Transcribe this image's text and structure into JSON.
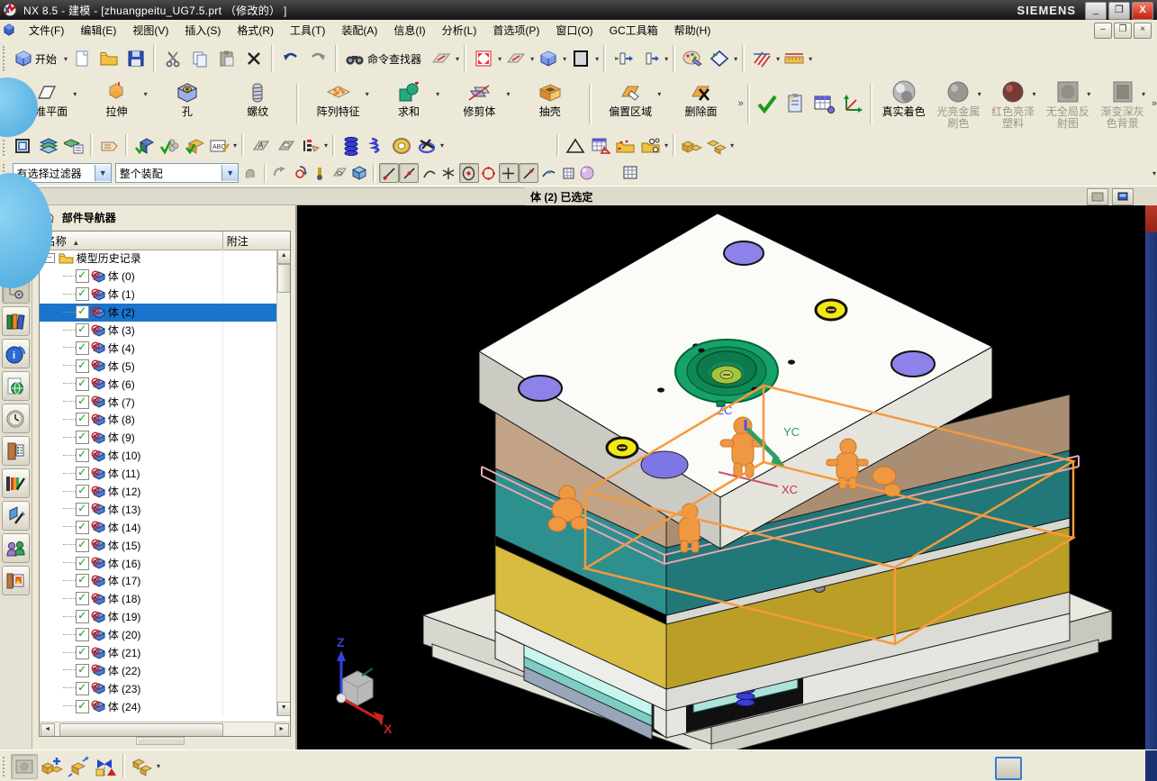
{
  "window": {
    "title": "NX 8.5 - 建模 - [zhuangpeitu_UG7.5.prt （修改的） ]",
    "brand": "SIEMENS",
    "buttons": {
      "minimize": "_",
      "restore": "❐",
      "close": "X"
    }
  },
  "menu": {
    "items": [
      "文件(F)",
      "编辑(E)",
      "视图(V)",
      "插入(S)",
      "格式(R)",
      "工具(T)",
      "装配(A)",
      "信息(I)",
      "分析(L)",
      "首选项(P)",
      "窗口(O)",
      "GC工具箱",
      "帮助(H)"
    ]
  },
  "toolbar_standard": {
    "start_label": "开始",
    "command_finder_label": "命令查找器"
  },
  "feature_toolbar": {
    "buttons": [
      {
        "label": "基准平面",
        "icon": "datum",
        "dropdown": true
      },
      {
        "label": "拉伸",
        "icon": "extrude",
        "dropdown": true
      },
      {
        "label": "孔",
        "icon": "hole",
        "dropdown": false
      },
      {
        "label": "螺纹",
        "icon": "thread",
        "dropdown": false
      },
      {
        "label": "阵列特征",
        "icon": "pattern",
        "dropdown": true
      },
      {
        "label": "求和",
        "icon": "unite",
        "dropdown": true
      },
      {
        "label": "修剪体",
        "icon": "trim",
        "dropdown": true
      },
      {
        "label": "抽壳",
        "icon": "shell",
        "dropdown": false
      },
      {
        "label": "偏置区域",
        "icon": "offsetr",
        "dropdown": true
      },
      {
        "label": "删除面",
        "icon": "delface",
        "dropdown": false
      }
    ],
    "shading_buttons": [
      {
        "label": "真实着色",
        "icon": "realshade",
        "disabled": false,
        "dropdown": false
      },
      {
        "label": "光亮金属刷色",
        "icon": "matmetal",
        "disabled": true,
        "dropdown": true
      },
      {
        "label": "红色亮泽塑料",
        "icon": "matred",
        "disabled": true,
        "dropdown": true
      },
      {
        "label": "无全局反射图",
        "icon": "matflat",
        "disabled": true,
        "dropdown": true
      },
      {
        "label": "渐变深灰色背景",
        "icon": "matbg",
        "disabled": true,
        "dropdown": true
      }
    ]
  },
  "selection_bar": {
    "filter_value": "有选择过滤器",
    "scope_value": "整个装配"
  },
  "prompt_bar": {
    "message": "体 (2) 已选定"
  },
  "navigator": {
    "title": "部件导航器",
    "columns": {
      "name": "名称",
      "note": "附注"
    },
    "root_label": "模型历史记录",
    "selected_index": 2,
    "items": [
      "体 (0)",
      "体 (1)",
      "体 (2)",
      "体 (3)",
      "体 (4)",
      "体 (5)",
      "体 (6)",
      "体 (7)",
      "体 (8)",
      "体 (9)",
      "体 (10)",
      "体 (11)",
      "体 (12)",
      "体 (13)",
      "体 (14)",
      "体 (15)",
      "体 (16)",
      "体 (17)",
      "体 (18)",
      "体 (19)",
      "体 (20)",
      "体 (21)",
      "体 (22)",
      "体 (23)",
      "体 (24)"
    ]
  },
  "viewport": {
    "wcs_labels": {
      "xc": "XC",
      "yc": "YC",
      "zc": "ZC"
    },
    "triad_labels": {
      "x": "X",
      "z": "Z"
    }
  },
  "colors": {
    "selection_highlight": "#1874cd",
    "viewport_background": "#000000",
    "selected_body_orange": "#f09742",
    "a_plate_teal": "#2e8f8f",
    "b_plate_yellow": "#cdb53a",
    "locating_ring_green": "#17a26b",
    "guide_hole_purple": "#7d76e6",
    "spring_blue": "#3d3dcf",
    "ejector_cyan": "#c9f5ef"
  }
}
